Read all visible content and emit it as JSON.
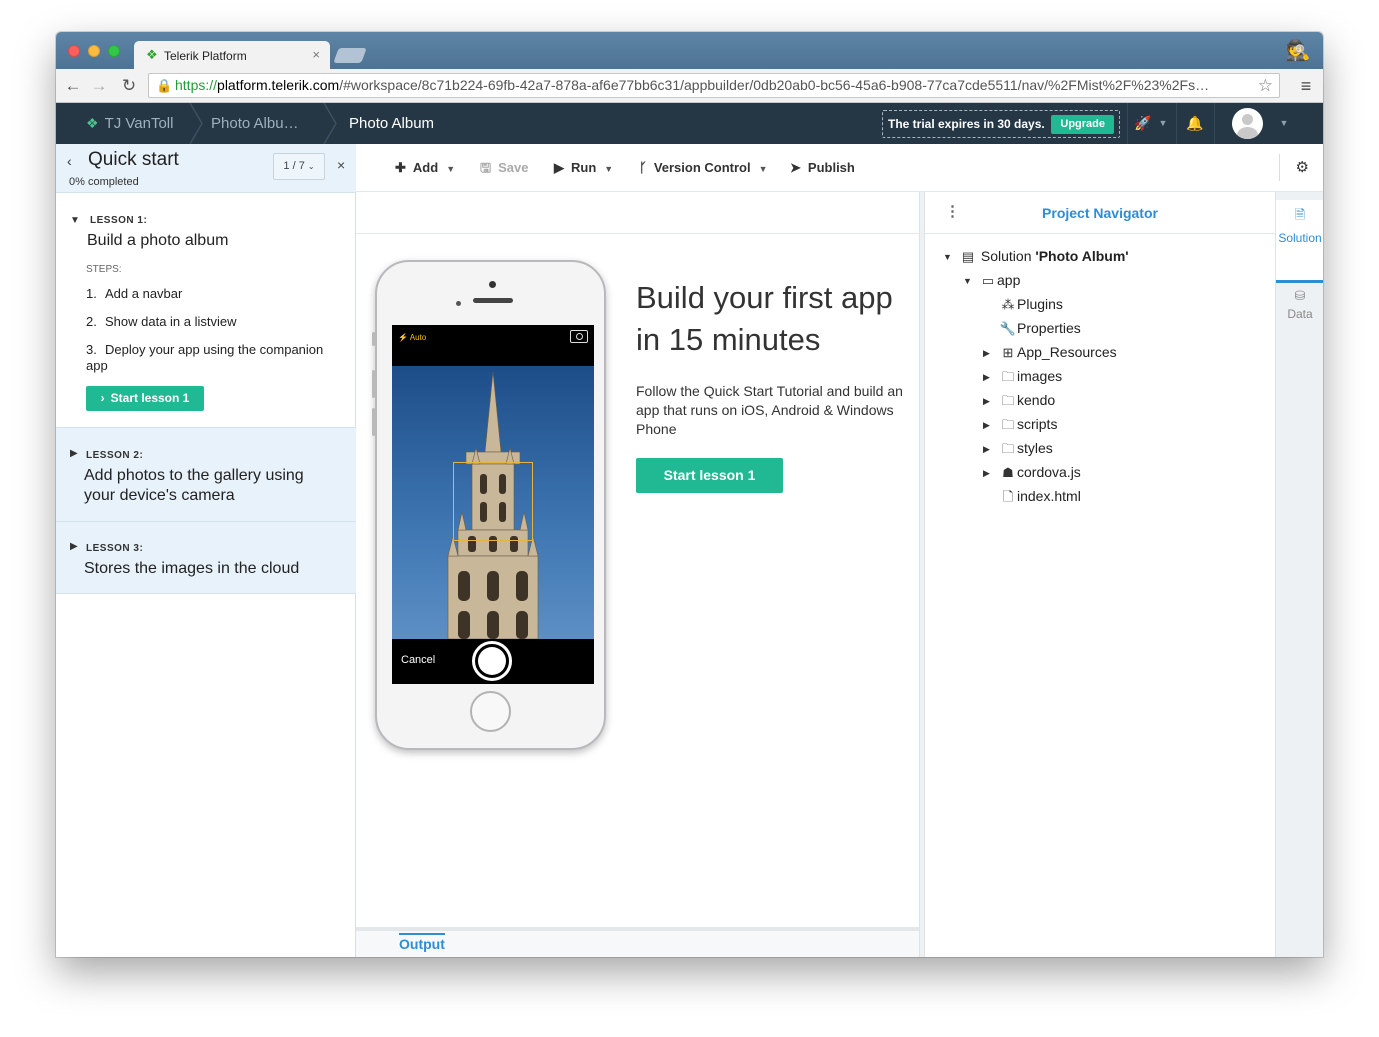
{
  "browser": {
    "tab_title": "Telerik Platform",
    "tab_close": "×",
    "url_scheme": "https://",
    "url_host": "platform.telerik.com",
    "url_rest": "/#workspace/8c71b224-69fb-42a7-878a-af6e77bb6c31/appbuilder/0db20ab0-bc56-45a6-b908-77ca7cde5511/nav/%2FMist%2F%23%2Fs…"
  },
  "header": {
    "user": "TJ VanToll",
    "project_crumb": "Photo Albu…",
    "current": "Photo Album",
    "trial_text": "The trial expires in 30 days.",
    "upgrade": "Upgrade"
  },
  "quickstart": {
    "title": "Quick start",
    "progress": "0% completed",
    "pager": "1 / 7",
    "lessons": [
      {
        "kicker": "LESSON 1:",
        "name": "Build a photo album",
        "steps_label": "STEPS:",
        "steps": [
          {
            "num": "1.",
            "text": "Add a navbar"
          },
          {
            "num": "2.",
            "text": "Show data in a listview"
          },
          {
            "num": "3.",
            "text": "Deploy your app using the companion app"
          }
        ],
        "button": "Start lesson 1"
      },
      {
        "kicker": "LESSON 2:",
        "name": "Add photos to the gallery using your device's camera"
      },
      {
        "kicker": "LESSON 3:",
        "name": "Stores the images in the cloud"
      }
    ]
  },
  "toolbar": {
    "add": "Add",
    "save": "Save",
    "run": "Run",
    "version_control": "Version Control",
    "publish": "Publish"
  },
  "editor": {
    "phone": {
      "flash": "Auto",
      "cancel": "Cancel"
    },
    "hero_title": "Build your first app in 15 minutes",
    "hero_text": "Follow the Quick Start Tutorial and build an app that runs on iOS, Android & Windows Phone",
    "hero_button": "Start lesson 1",
    "output_tab": "Output"
  },
  "navigator": {
    "title": "Project Navigator",
    "solution_prefix": "Solution",
    "solution_name": "'Photo Album'",
    "tree": {
      "app": "app",
      "plugins": "Plugins",
      "properties": "Properties",
      "app_resources": "App_Resources",
      "images": "images",
      "kendo": "kendo",
      "scripts": "scripts",
      "styles": "styles",
      "cordova": "cordova.js",
      "index": "index.html"
    }
  },
  "rail": {
    "solution": "Solution",
    "data": "Data"
  },
  "colors": {
    "accent_green": "#20b993",
    "accent_blue": "#2d8dd6",
    "header_dark": "#253645"
  }
}
